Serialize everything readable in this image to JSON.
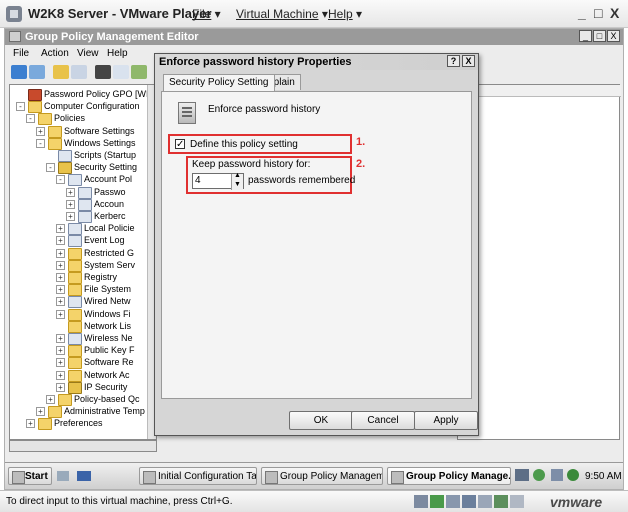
{
  "vmware": {
    "title": "W2K8 Server - VMware Player",
    "menu": {
      "file": "File",
      "vm": "Virtual Machine",
      "help": "Help"
    },
    "window_controls": {
      "min": "_",
      "max": "□",
      "close": "X"
    }
  },
  "gpme": {
    "title": "Group Policy Management Editor",
    "menu": [
      "File",
      "Action",
      "View",
      "Help"
    ],
    "window_controls": {
      "min": "_",
      "max": "□",
      "close": "X"
    },
    "tree": [
      {
        "label": "Password Policy GPO [WIN-RN1",
        "level": 0,
        "icon": "gpo",
        "exp": ""
      },
      {
        "label": "Computer Configuration",
        "level": 0,
        "icon": "computer",
        "exp": "-"
      },
      {
        "label": "Policies",
        "level": 1,
        "icon": "folder",
        "exp": "-"
      },
      {
        "label": "Software Settings",
        "level": 2,
        "icon": "folder",
        "exp": "+"
      },
      {
        "label": "Windows Settings",
        "level": 2,
        "icon": "folder",
        "exp": "-"
      },
      {
        "label": "Scripts (Startup",
        "level": 3,
        "icon": "doc",
        "exp": ""
      },
      {
        "label": "Security Setting",
        "level": 3,
        "icon": "lock",
        "exp": "-"
      },
      {
        "label": "Account Pol",
        "level": 4,
        "icon": "doc",
        "exp": "-"
      },
      {
        "label": "Passwo",
        "level": 5,
        "icon": "doc",
        "exp": "+"
      },
      {
        "label": "Accoun",
        "level": 5,
        "icon": "doc",
        "exp": "+"
      },
      {
        "label": "Kerberc",
        "level": 5,
        "icon": "doc",
        "exp": "+"
      },
      {
        "label": "Local Policie",
        "level": 4,
        "icon": "doc",
        "exp": "+"
      },
      {
        "label": "Event Log",
        "level": 4,
        "icon": "doc",
        "exp": "+"
      },
      {
        "label": "Restricted G",
        "level": 4,
        "icon": "folder",
        "exp": "+"
      },
      {
        "label": "System Serv",
        "level": 4,
        "icon": "folder",
        "exp": "+"
      },
      {
        "label": "Registry",
        "level": 4,
        "icon": "folder",
        "exp": "+"
      },
      {
        "label": "File System",
        "level": 4,
        "icon": "folder",
        "exp": "+"
      },
      {
        "label": "Wired Netw",
        "level": 4,
        "icon": "doc",
        "exp": "+"
      },
      {
        "label": "Windows Fi",
        "level": 4,
        "icon": "folder",
        "exp": "+"
      },
      {
        "label": "Network Lis",
        "level": 4,
        "icon": "folder",
        "exp": ""
      },
      {
        "label": "Wireless Ne",
        "level": 4,
        "icon": "doc",
        "exp": "+"
      },
      {
        "label": "Public Key F",
        "level": 4,
        "icon": "folder",
        "exp": "+"
      },
      {
        "label": "Software Re",
        "level": 4,
        "icon": "folder",
        "exp": "+"
      },
      {
        "label": "Network Ac",
        "level": 4,
        "icon": "folder",
        "exp": "+"
      },
      {
        "label": "IP Security",
        "level": 4,
        "icon": "lock",
        "exp": "+"
      },
      {
        "label": "Policy-based Qc",
        "level": 3,
        "icon": "chart",
        "exp": "+"
      },
      {
        "label": "Administrative Temp",
        "level": 2,
        "icon": "folder",
        "exp": "+"
      },
      {
        "label": "Preferences",
        "level": 1,
        "icon": "folder",
        "exp": "+"
      }
    ]
  },
  "dialog": {
    "title": "Enforce password history Properties",
    "help_btn": "?",
    "close_btn": "X",
    "tabs": [
      "Security Policy Setting",
      "Explain"
    ],
    "policy_name": "Enforce password history",
    "define_label": "Define this policy setting",
    "define_checked": true,
    "keep_label": "Keep password history for:",
    "history_value": "4",
    "remembered_label": "passwords remembered",
    "callout_1": "1.",
    "callout_2": "2.",
    "buttons": {
      "ok": "OK",
      "cancel": "Cancel",
      "apply": "Apply"
    }
  },
  "taskbar": {
    "start": "Start",
    "items": [
      {
        "label": "Initial Configuration Tasks",
        "active": false
      },
      {
        "label": "Group Policy Management",
        "active": false
      },
      {
        "label": "Group Policy Manage...",
        "active": true
      }
    ],
    "clock": "9:50 AM"
  },
  "statusbar": {
    "text": "To direct input to this virtual machine, press Ctrl+G.",
    "brand": "vmware"
  },
  "colors": {
    "callout": "#e03030",
    "brand": "#4a4a4a"
  }
}
